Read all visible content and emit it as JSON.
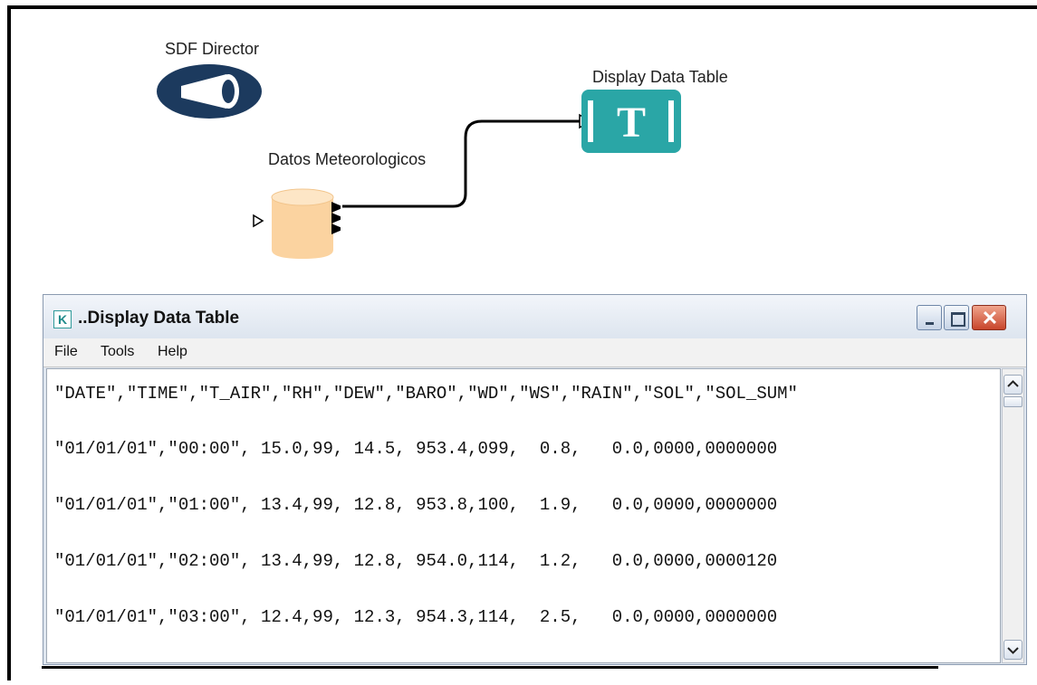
{
  "workflow": {
    "director_label": "SDF Director",
    "source_label": "Datos Meteorologicos",
    "display_label": "Display Data Table"
  },
  "window": {
    "title": "..Display Data Table",
    "app_icon": "K",
    "menu": [
      "File",
      "Tools",
      "Help"
    ],
    "lines": [
      "\"DATE\",\"TIME\",\"T_AIR\",\"RH\",\"DEW\",\"BARO\",\"WD\",\"WS\",\"RAIN\",\"SOL\",\"SOL_SUM\"",
      "\"01/01/01\",\"00:00\", 15.0,99, 14.5, 953.4,099,  0.8,   0.0,0000,0000000",
      "\"01/01/01\",\"01:00\", 13.4,99, 12.8, 953.8,100,  1.9,   0.0,0000,0000000",
      "\"01/01/01\",\"02:00\", 13.4,99, 12.8, 954.0,114,  1.2,   0.0,0000,0000120",
      "\"01/01/01\",\"03:00\", 12.4,99, 12.3, 954.3,114,  2.5,   0.0,0000,0000000"
    ]
  },
  "colors": {
    "director_navy": "#1c3a5e",
    "source_fill": "#fbd3a0",
    "display_teal": "#2aa6a6",
    "close_red": "#c8452b"
  }
}
